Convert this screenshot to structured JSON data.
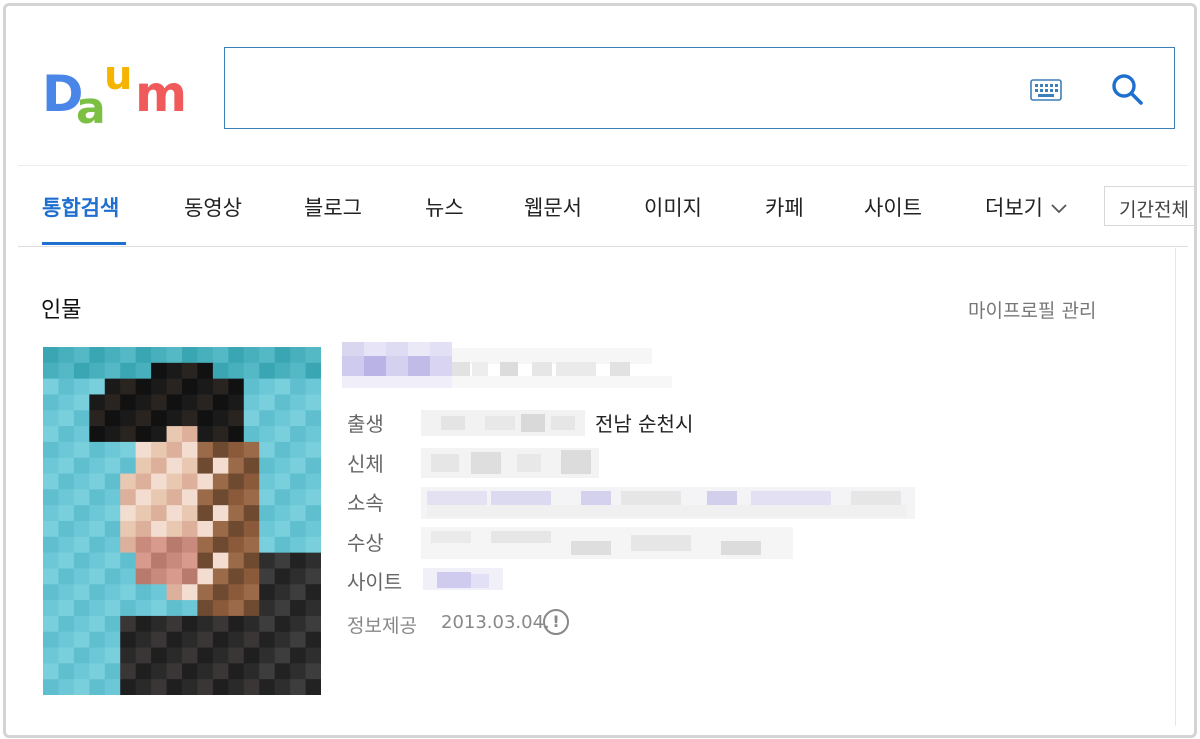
{
  "logo": {
    "text": "Daum",
    "colors": [
      "#4a86e8",
      "#f4b400",
      "#7bc043",
      "#f05a5a",
      "#e8466a"
    ]
  },
  "search": {
    "value": "",
    "placeholder": "",
    "keyboard_icon": "keyboard-icon",
    "search_icon": "search-icon"
  },
  "tabs": [
    {
      "label": "통합검색",
      "active": true
    },
    {
      "label": "동영상"
    },
    {
      "label": "블로그"
    },
    {
      "label": "뉴스"
    },
    {
      "label": "웹문서"
    },
    {
      "label": "이미지"
    },
    {
      "label": "카페"
    },
    {
      "label": "사이트"
    },
    {
      "label": "더보기"
    }
  ],
  "period_button": "기간전체",
  "accent_color": "#1f6fd1",
  "person": {
    "section_title": "인물",
    "profile_manage": "마이프로필 관리",
    "fields": {
      "birth_label": "출생",
      "birth_place": "전남 순천시",
      "body_label": "신체",
      "affiliation_label": "소속",
      "award_label": "수상",
      "site_label": "사이트"
    },
    "source_label": "정보제공",
    "source_date": "2013.03.04.",
    "alert_icon": "!"
  }
}
